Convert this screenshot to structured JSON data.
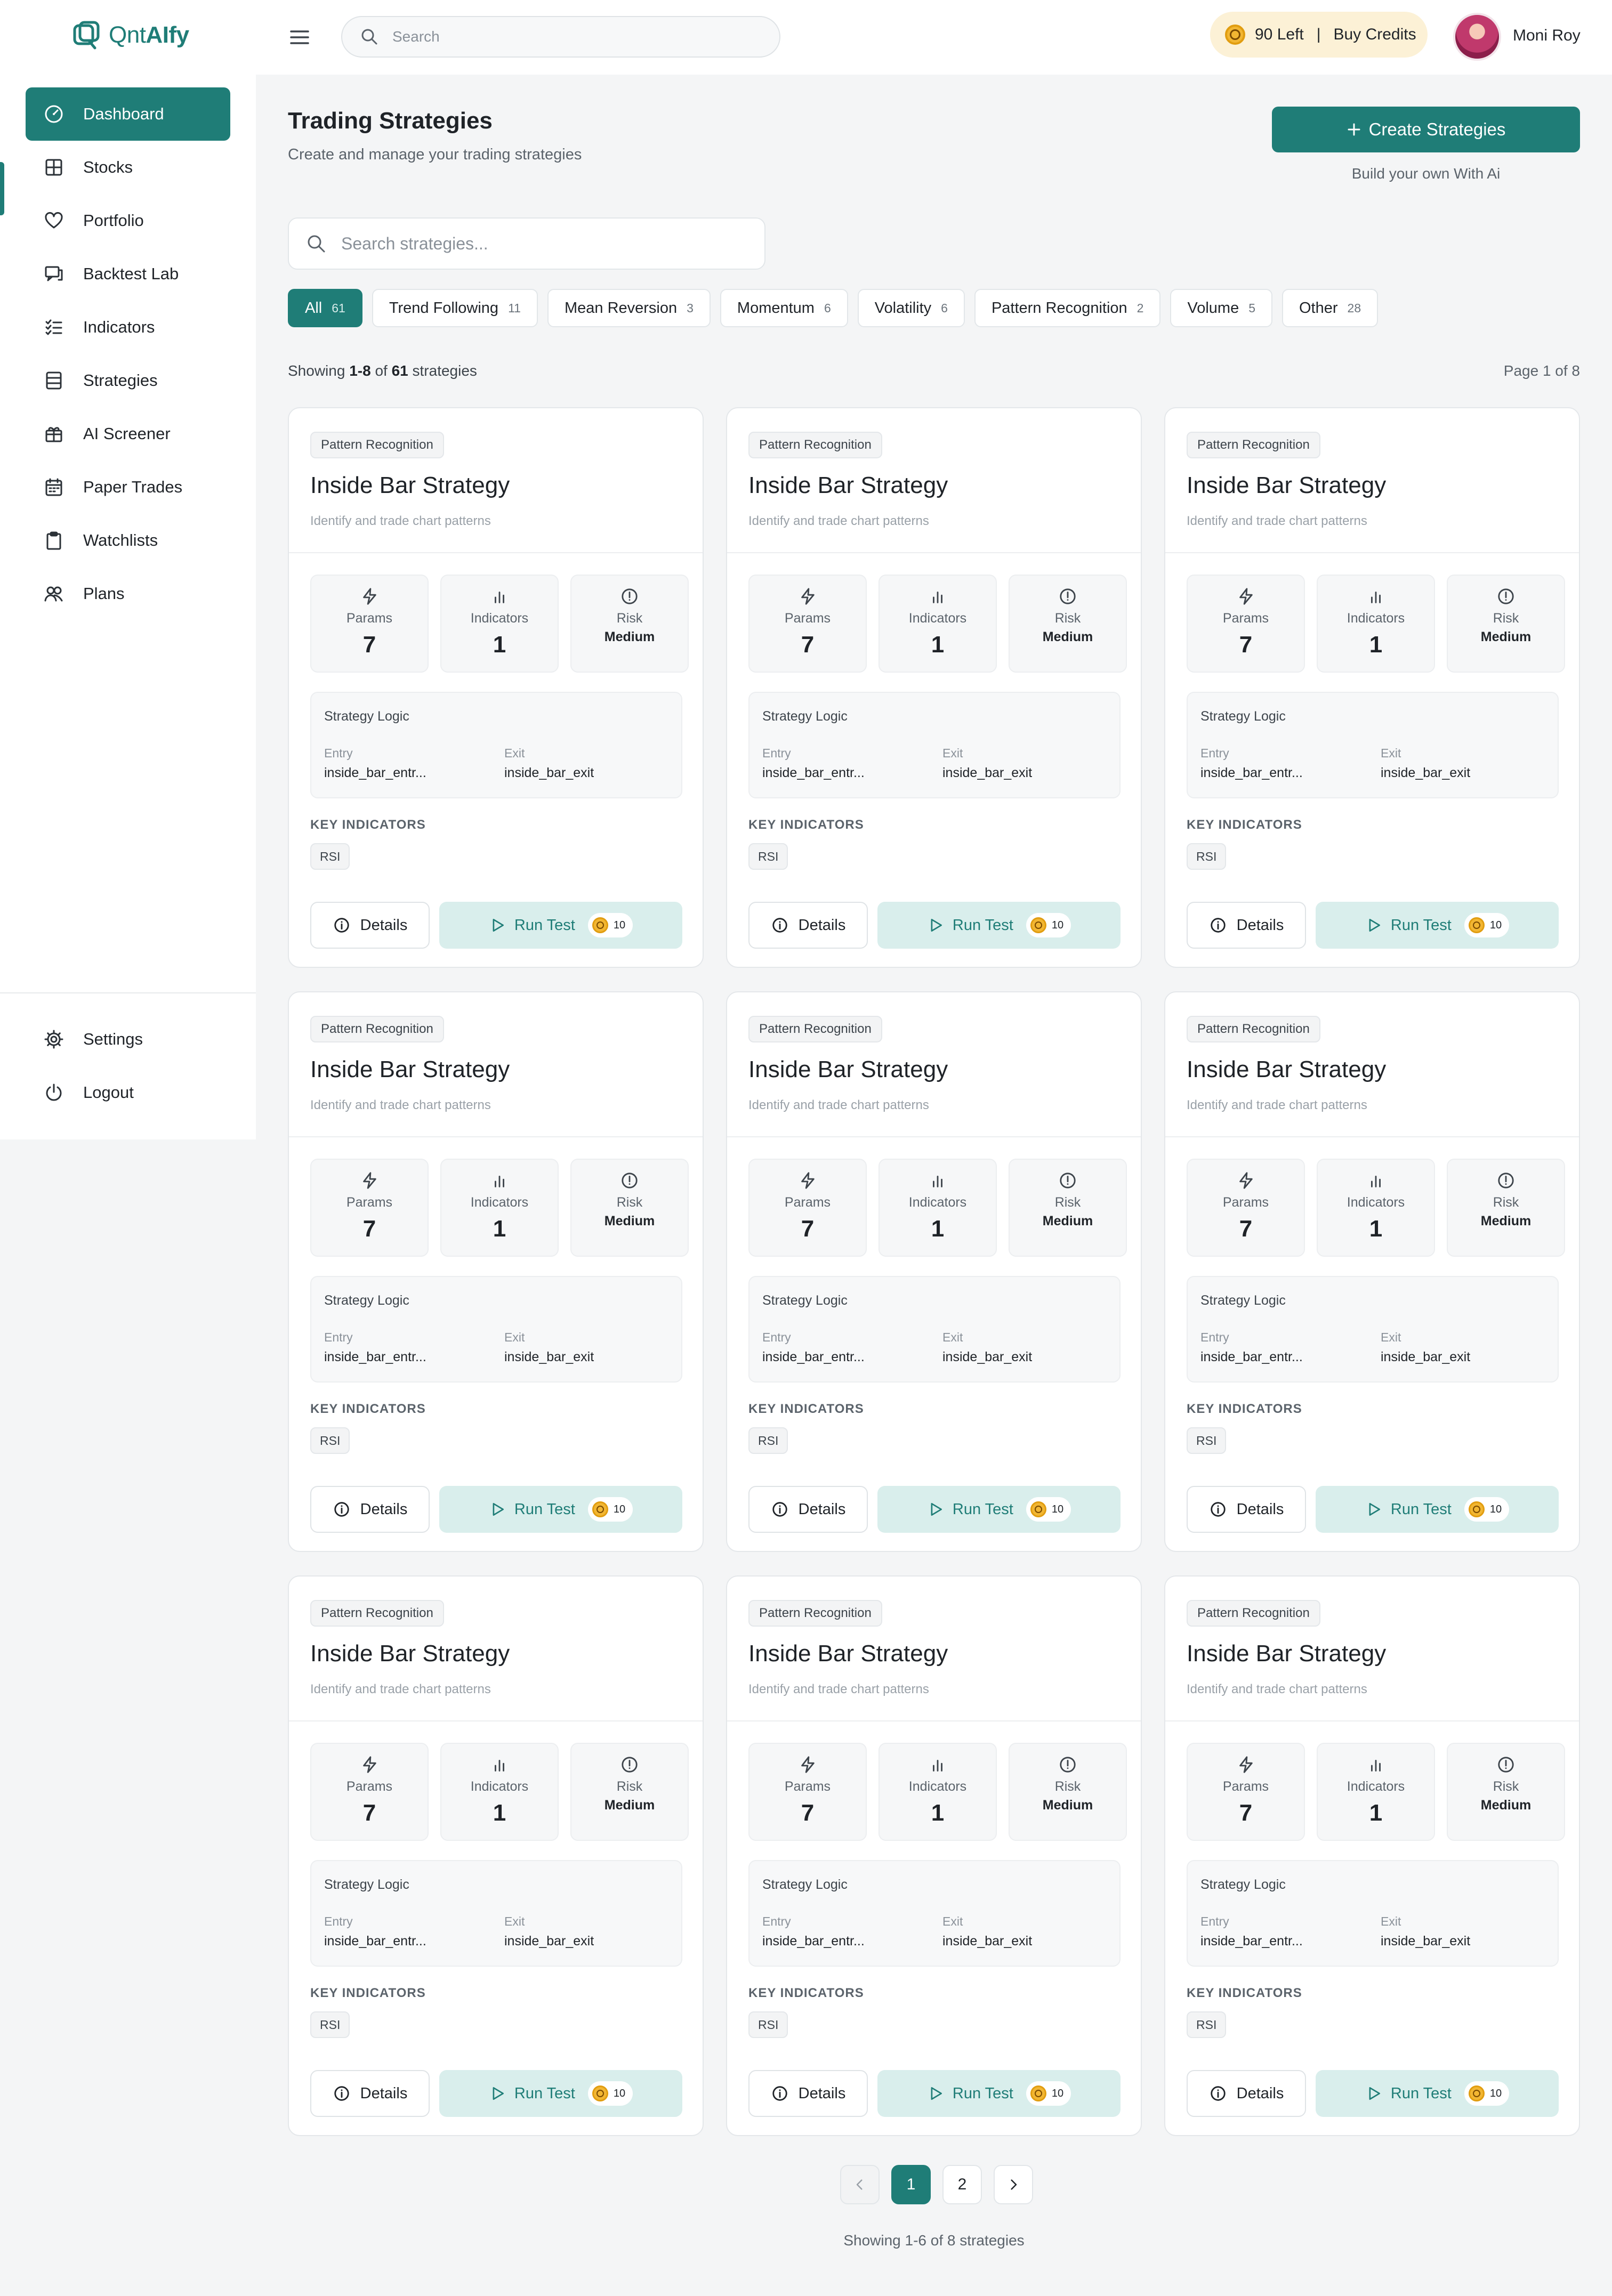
{
  "brand": {
    "prefix": "Qnt",
    "suffix": "AIfy"
  },
  "header": {
    "search_placeholder": "Search",
    "credits_left": "90 Left",
    "separator": "|",
    "buy_credits": "Buy Credits",
    "user_name": "Moni Roy"
  },
  "sidebar": {
    "items": [
      {
        "label": "Dashboard",
        "icon": "dashboard-icon"
      },
      {
        "label": "Stocks",
        "icon": "grid-icon"
      },
      {
        "label": "Portfolio",
        "icon": "heart-icon"
      },
      {
        "label": "Backtest Lab",
        "icon": "chat-icon"
      },
      {
        "label": "Indicators",
        "icon": "checklist-icon"
      },
      {
        "label": "Strategies",
        "icon": "list-icon"
      },
      {
        "label": "AI Screener",
        "icon": "gift-icon"
      },
      {
        "label": "Paper Trades",
        "icon": "calendar-icon"
      },
      {
        "label": "Watchlists",
        "icon": "clipboard-icon"
      },
      {
        "label": "Plans",
        "icon": "users-icon"
      }
    ],
    "bottom": [
      {
        "label": "Settings",
        "icon": "gear-icon"
      },
      {
        "label": "Logout",
        "icon": "power-icon"
      }
    ]
  },
  "main": {
    "title": "Trading Strategies",
    "subtitle": "Create and manage your trading strategies",
    "create_button": "Create Strategies",
    "create_hint": "Build your own With Ai",
    "search_placeholder": "Search strategies...",
    "filters": [
      {
        "label": "All",
        "count": "61"
      },
      {
        "label": "Trend Following",
        "count": "11"
      },
      {
        "label": "Mean Reversion",
        "count": "3"
      },
      {
        "label": "Momentum",
        "count": "6"
      },
      {
        "label": "Volatility",
        "count": "6"
      },
      {
        "label": "Pattern Recognition",
        "count": "2"
      },
      {
        "label": "Volume",
        "count": "5"
      },
      {
        "label": "Other",
        "count": "28"
      }
    ],
    "showing": {
      "prefix": "Showing",
      "range": "1-8",
      "of": "of",
      "total": "61",
      "suffix": "strategies"
    },
    "page_of": "Page 1 of 8"
  },
  "card_labels": {
    "params": "Params",
    "indicators": "Indicators",
    "risk": "Risk",
    "logic_title": "Strategy Logic",
    "entry": "Entry",
    "exit": "Exit",
    "key_indicators": "KEY INDICATORS",
    "details": "Details",
    "run_test": "Run Test"
  },
  "cards": [
    {
      "category": "Pattern Recognition",
      "title": "Inside Bar Strategy",
      "description": "Identify and trade chart patterns",
      "params": "7",
      "indicators": "1",
      "risk": "Medium",
      "entry": "inside_bar_entr...",
      "exit": "inside_bar_exit",
      "key_indicators": [
        "RSI"
      ],
      "cost": "10"
    },
    {
      "category": "Pattern Recognition",
      "title": "Inside Bar Strategy",
      "description": "Identify and trade chart patterns",
      "params": "7",
      "indicators": "1",
      "risk": "Medium",
      "entry": "inside_bar_entr...",
      "exit": "inside_bar_exit",
      "key_indicators": [
        "RSI"
      ],
      "cost": "10"
    },
    {
      "category": "Pattern Recognition",
      "title": "Inside Bar Strategy",
      "description": "Identify and trade chart patterns",
      "params": "7",
      "indicators": "1",
      "risk": "Medium",
      "entry": "inside_bar_entr...",
      "exit": "inside_bar_exit",
      "key_indicators": [
        "RSI"
      ],
      "cost": "10"
    },
    {
      "category": "Pattern Recognition",
      "title": "Inside Bar Strategy",
      "description": "Identify and trade chart patterns",
      "params": "7",
      "indicators": "1",
      "risk": "Medium",
      "entry": "inside_bar_entr...",
      "exit": "inside_bar_exit",
      "key_indicators": [
        "RSI"
      ],
      "cost": "10"
    },
    {
      "category": "Pattern Recognition",
      "title": "Inside Bar Strategy",
      "description": "Identify and trade chart patterns",
      "params": "7",
      "indicators": "1",
      "risk": "Medium",
      "entry": "inside_bar_entr...",
      "exit": "inside_bar_exit",
      "key_indicators": [
        "RSI"
      ],
      "cost": "10"
    },
    {
      "category": "Pattern Recognition",
      "title": "Inside Bar Strategy",
      "description": "Identify and trade chart patterns",
      "params": "7",
      "indicators": "1",
      "risk": "Medium",
      "entry": "inside_bar_entr...",
      "exit": "inside_bar_exit",
      "key_indicators": [
        "RSI"
      ],
      "cost": "10"
    },
    {
      "category": "Pattern Recognition",
      "title": "Inside Bar Strategy",
      "description": "Identify and trade chart patterns",
      "params": "7",
      "indicators": "1",
      "risk": "Medium",
      "entry": "inside_bar_entr...",
      "exit": "inside_bar_exit",
      "key_indicators": [
        "RSI"
      ],
      "cost": "10"
    },
    {
      "category": "Pattern Recognition",
      "title": "Inside Bar Strategy",
      "description": "Identify and trade chart patterns",
      "params": "7",
      "indicators": "1",
      "risk": "Medium",
      "entry": "inside_bar_entr...",
      "exit": "inside_bar_exit",
      "key_indicators": [
        "RSI"
      ],
      "cost": "10"
    },
    {
      "category": "Pattern Recognition",
      "title": "Inside Bar Strategy",
      "description": "Identify and trade chart patterns",
      "params": "7",
      "indicators": "1",
      "risk": "Medium",
      "entry": "inside_bar_entr...",
      "exit": "inside_bar_exit",
      "key_indicators": [
        "RSI"
      ],
      "cost": "10"
    }
  ],
  "pagination": {
    "pages": [
      "1",
      "2"
    ],
    "current": "1",
    "footer": "Showing 1-6 of 8 strategies"
  },
  "colors": {
    "primary": "#1f7d77",
    "primary_soft": "#d9eeec",
    "credits_bg": "#fcf1d6",
    "coin": "#f2b632"
  }
}
